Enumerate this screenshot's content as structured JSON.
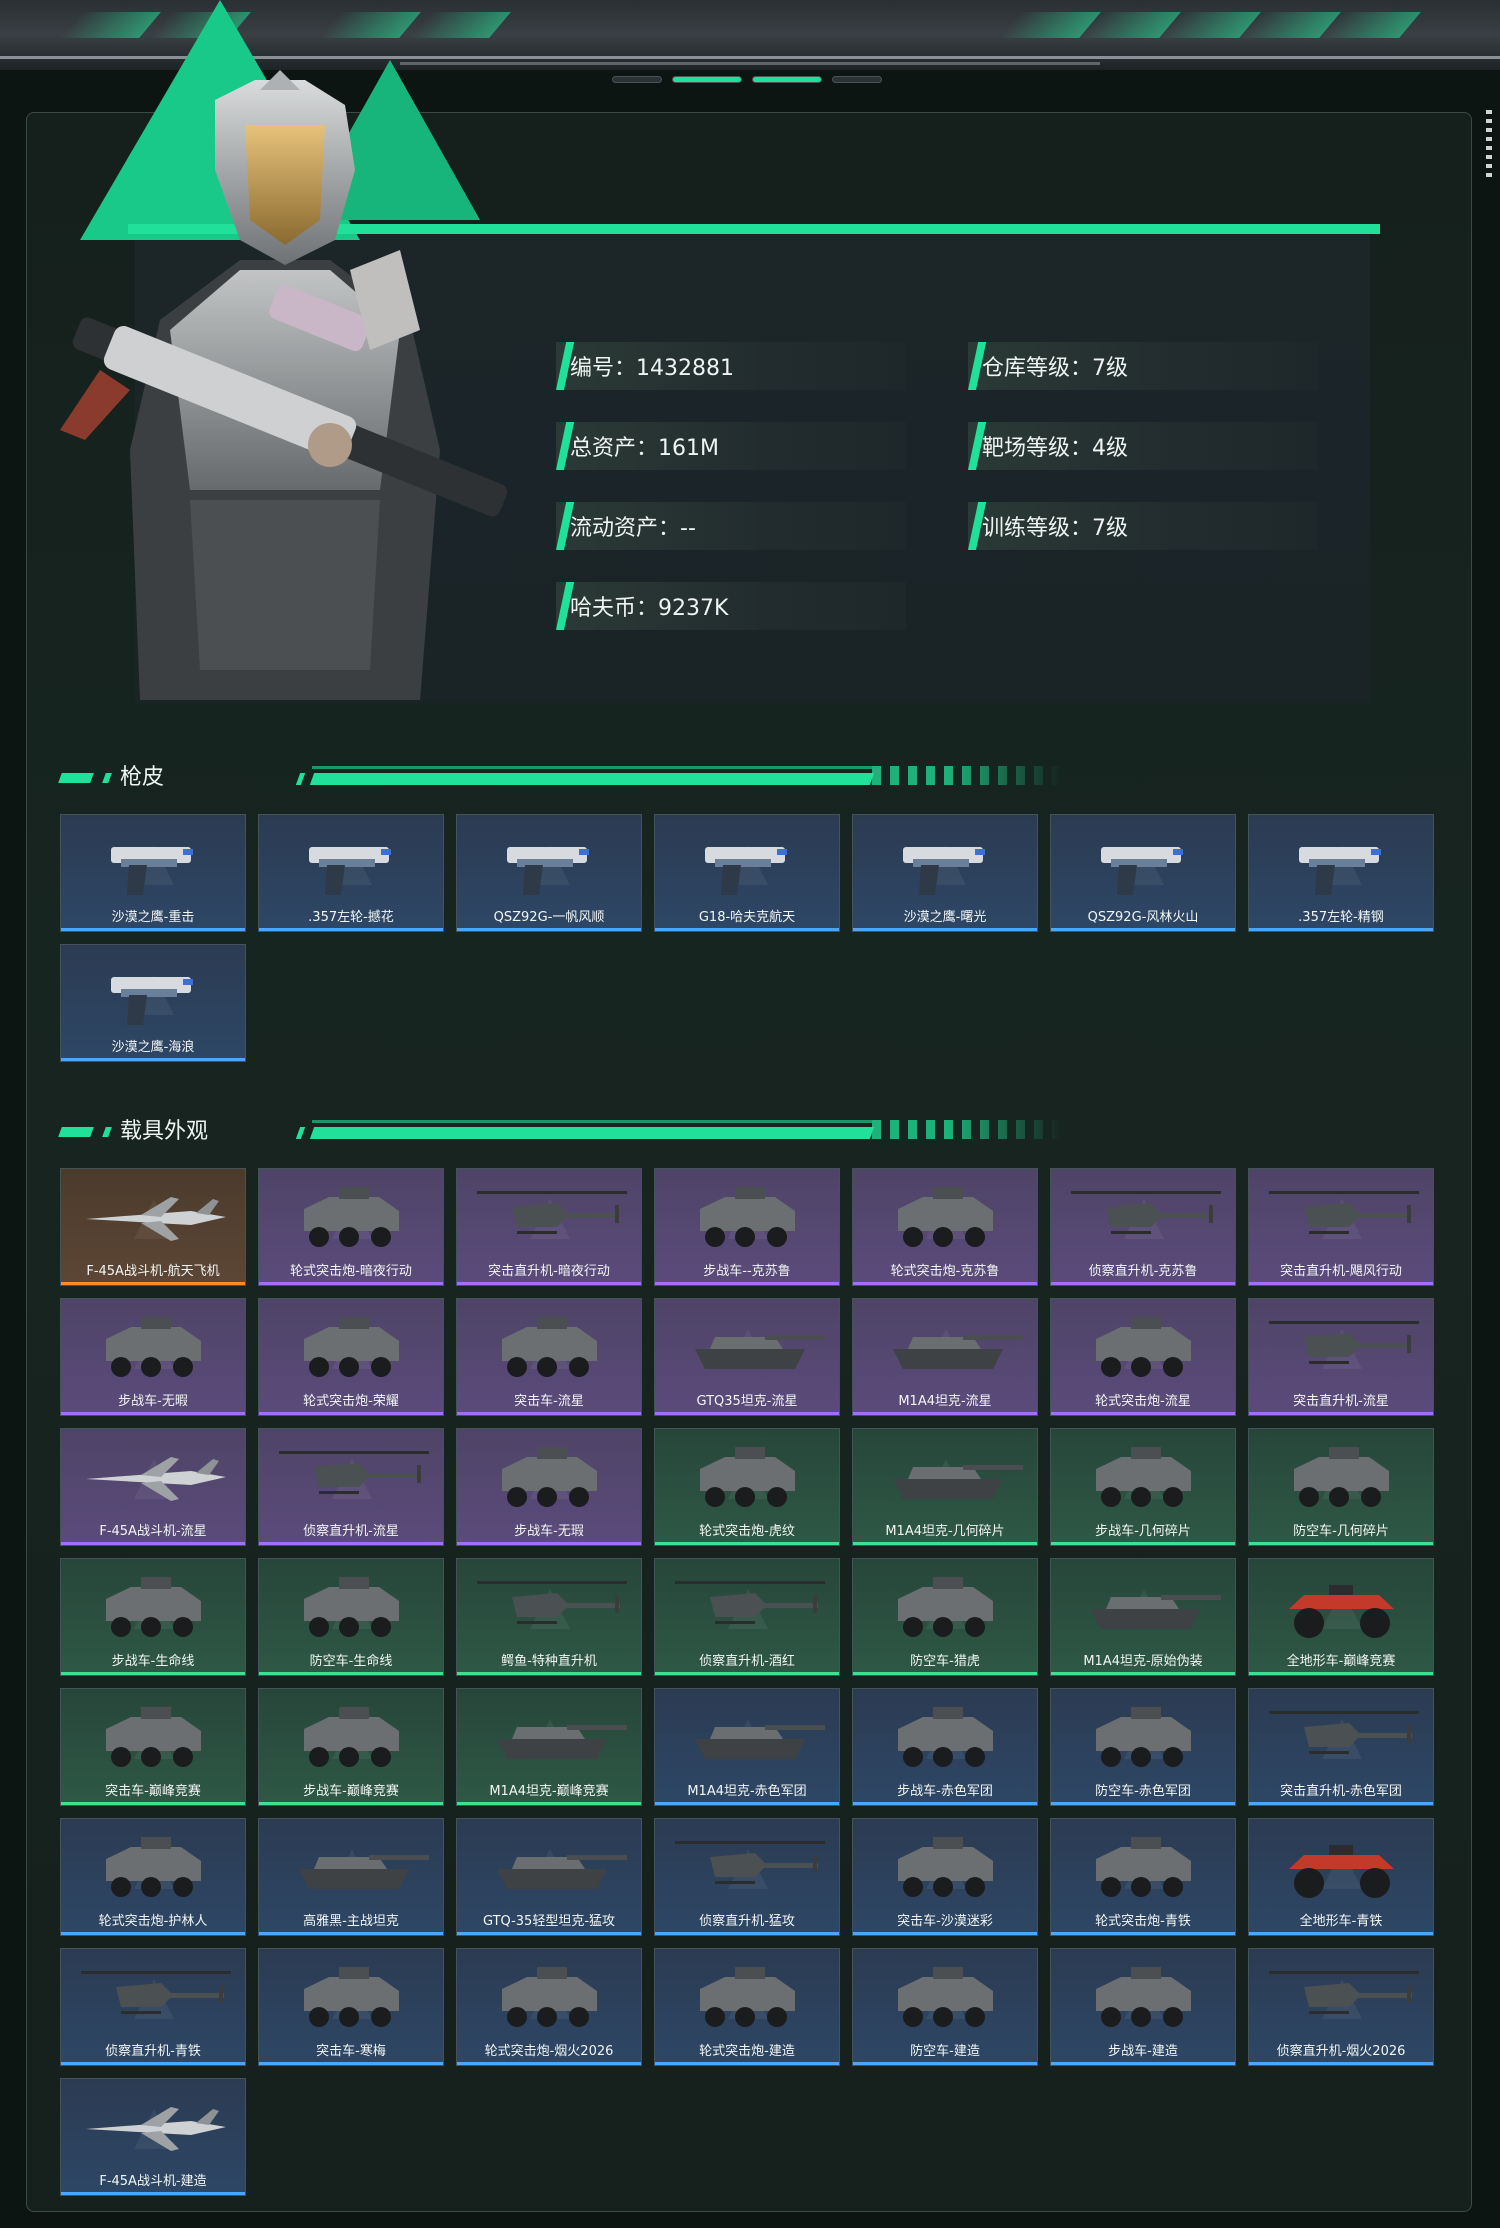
{
  "profile": {
    "stats": [
      {
        "label": "编号：1432881"
      },
      {
        "label": "仓库等级：7级"
      },
      {
        "label": "总资产：161M"
      },
      {
        "label": "靶场等级：4级"
      },
      {
        "label": "流动资产：--"
      },
      {
        "label": "训练等级：7级"
      },
      {
        "label": "哈夫币：9237K"
      }
    ]
  },
  "sections": {
    "gun_skins": {
      "title": "枪皮",
      "items": [
        {
          "name": "沙漠之鹰-重击",
          "quality": "blue",
          "icon": "pistol-icon"
        },
        {
          "name": ".357左轮-撼花",
          "quality": "blue",
          "icon": "pistol-icon"
        },
        {
          "name": "QSZ92G-一帆风顺",
          "quality": "blue",
          "icon": "pistol-icon"
        },
        {
          "name": "G18-哈夫克航天",
          "quality": "blue",
          "icon": "pistol-icon"
        },
        {
          "name": "沙漠之鹰-曙光",
          "quality": "blue",
          "icon": "pistol-icon"
        },
        {
          "name": "QSZ92G-风林火山",
          "quality": "blue",
          "icon": "pistol-icon"
        },
        {
          "name": ".357左轮-精钢",
          "quality": "blue",
          "icon": "pistol-icon"
        },
        {
          "name": "沙漠之鹰-海浪",
          "quality": "blue",
          "icon": "pistol-icon"
        }
      ]
    },
    "vehicles": {
      "title": "载具外观",
      "items": [
        {
          "name": "F-45A战斗机-航天飞机",
          "quality": "orange",
          "icon": "jet-icon"
        },
        {
          "name": "轮式突击炮-暗夜行动",
          "quality": "purple",
          "icon": "vehicle-icon"
        },
        {
          "name": "突击直升机-暗夜行动",
          "quality": "purple",
          "icon": "helicopter-icon"
        },
        {
          "name": "步战车--克苏鲁",
          "quality": "purple",
          "icon": "vehicle-icon"
        },
        {
          "name": "轮式突击炮-克苏鲁",
          "quality": "purple",
          "icon": "vehicle-icon"
        },
        {
          "name": "侦察直升机-克苏鲁",
          "quality": "purple",
          "icon": "helicopter-icon"
        },
        {
          "name": "突击直升机-飓风行动",
          "quality": "purple",
          "icon": "helicopter-icon"
        },
        {
          "name": "步战车-无暇",
          "quality": "purple",
          "icon": "vehicle-icon"
        },
        {
          "name": "轮式突击炮-荣耀",
          "quality": "purple",
          "icon": "vehicle-icon"
        },
        {
          "name": "突击车-流星",
          "quality": "purple",
          "icon": "vehicle-icon"
        },
        {
          "name": "GTQ35坦克-流星",
          "quality": "purple",
          "icon": "tank-icon"
        },
        {
          "name": "M1A4坦克-流星",
          "quality": "purple",
          "icon": "tank-icon"
        },
        {
          "name": "轮式突击炮-流星",
          "quality": "purple",
          "icon": "vehicle-icon"
        },
        {
          "name": "突击直升机-流星",
          "quality": "purple",
          "icon": "helicopter-icon"
        },
        {
          "name": "F-45A战斗机-流星",
          "quality": "purple",
          "icon": "jet-icon"
        },
        {
          "name": "侦察直升机-流星",
          "quality": "purple",
          "icon": "helicopter-icon"
        },
        {
          "name": "步战车-无瑕",
          "quality": "purple",
          "icon": "vehicle-icon"
        },
        {
          "name": "轮式突击炮-虎纹",
          "quality": "green",
          "icon": "vehicle-icon"
        },
        {
          "name": "M1A4坦克-几何碎片",
          "quality": "green",
          "icon": "tank-icon"
        },
        {
          "name": "步战车-几何碎片",
          "quality": "green",
          "icon": "vehicle-icon"
        },
        {
          "name": "防空车-几何碎片",
          "quality": "green",
          "icon": "vehicle-icon"
        },
        {
          "name": "步战车-生命线",
          "quality": "green",
          "icon": "vehicle-icon"
        },
        {
          "name": "防空车-生命线",
          "quality": "green",
          "icon": "vehicle-icon"
        },
        {
          "name": "鳄鱼-特种直升机",
          "quality": "green",
          "icon": "helicopter-icon"
        },
        {
          "name": "侦察直升机-酒红",
          "quality": "green",
          "icon": "helicopter-icon"
        },
        {
          "name": "防空车-猎虎",
          "quality": "green",
          "icon": "vehicle-icon"
        },
        {
          "name": "M1A4坦克-原始伪装",
          "quality": "green",
          "icon": "tank-icon"
        },
        {
          "name": "全地形车-巅峰竞赛",
          "quality": "green",
          "icon": "atv-icon"
        },
        {
          "name": "突击车-巅峰竞赛",
          "quality": "green",
          "icon": "vehicle-icon"
        },
        {
          "name": "步战车-巅峰竞赛",
          "quality": "green",
          "icon": "vehicle-icon"
        },
        {
          "name": "M1A4坦克-巅峰竞赛",
          "quality": "green",
          "icon": "tank-icon"
        },
        {
          "name": "M1A4坦克-赤色军团",
          "quality": "blue",
          "icon": "tank-icon"
        },
        {
          "name": "步战车-赤色军团",
          "quality": "blue",
          "icon": "vehicle-icon"
        },
        {
          "name": "防空车-赤色军团",
          "quality": "blue",
          "icon": "vehicle-icon"
        },
        {
          "name": "突击直升机-赤色军团",
          "quality": "blue",
          "icon": "helicopter-icon"
        },
        {
          "name": "轮式突击炮-护林人",
          "quality": "blue",
          "icon": "vehicle-icon"
        },
        {
          "name": "高雅黑-主战坦克",
          "quality": "blue",
          "icon": "tank-icon"
        },
        {
          "name": "GTQ-35轻型坦克-猛攻",
          "quality": "blue",
          "icon": "tank-icon"
        },
        {
          "name": "侦察直升机-猛攻",
          "quality": "blue",
          "icon": "helicopter-icon"
        },
        {
          "name": "突击车-沙漠迷彩",
          "quality": "blue",
          "icon": "vehicle-icon"
        },
        {
          "name": "轮式突击炮-青铁",
          "quality": "blue",
          "icon": "vehicle-icon"
        },
        {
          "name": "全地形车-青铁",
          "quality": "blue",
          "icon": "atv-icon"
        },
        {
          "name": "侦察直升机-青铁",
          "quality": "blue",
          "icon": "helicopter-icon"
        },
        {
          "name": "突击车-寒梅",
          "quality": "blue",
          "icon": "vehicle-icon"
        },
        {
          "name": "轮式突击炮-烟火2026",
          "quality": "blue",
          "icon": "vehicle-icon"
        },
        {
          "name": "轮式突击炮-建造",
          "quality": "blue",
          "icon": "vehicle-icon"
        },
        {
          "name": "防空车-建造",
          "quality": "blue",
          "icon": "vehicle-icon"
        },
        {
          "name": "步战车-建造",
          "quality": "blue",
          "icon": "vehicle-icon"
        },
        {
          "name": "侦察直升机-烟火2026",
          "quality": "blue",
          "icon": "helicopter-icon"
        },
        {
          "name": "F-45A战斗机-建造",
          "quality": "blue",
          "icon": "jet-icon"
        }
      ]
    }
  },
  "colors": {
    "accent": "#21e19a",
    "quality_blue": "#4aa6ff",
    "quality_purple": "#a46cff",
    "quality_green": "#3fe08f",
    "quality_orange": "#ff8a2a"
  }
}
